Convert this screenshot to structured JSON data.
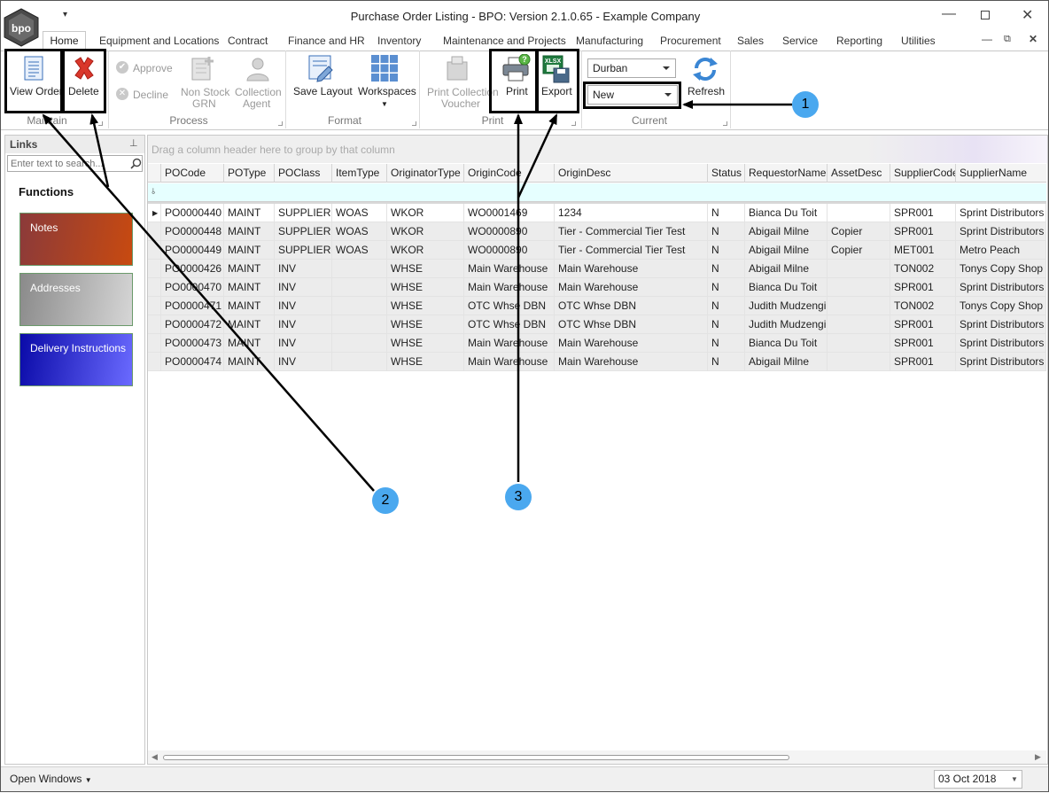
{
  "window": {
    "title": "Purchase Order Listing - BPO: Version 2.1.0.65 - Example Company",
    "logo_text": "bpo"
  },
  "menu_tabs": [
    "Home",
    "Equipment and Locations",
    "Contract",
    "Finance and HR",
    "Inventory",
    "Maintenance and Projects",
    "Manufacturing",
    "Procurement",
    "Sales",
    "Service",
    "Reporting",
    "Utilities"
  ],
  "ribbon": {
    "maintain": {
      "group": "Maintain",
      "view_order": "View Order",
      "delete": "Delete"
    },
    "process": {
      "group": "Process",
      "approve": "Approve",
      "decline": "Decline",
      "non_stock_1": "Non Stock",
      "non_stock_2": "GRN",
      "collection_1": "Collection",
      "collection_2": "Agent"
    },
    "format": {
      "group": "Format",
      "save_layout": "Save Layout",
      "workspaces": "Workspaces"
    },
    "print": {
      "group": "Print",
      "print_voucher_1": "Print Collection",
      "print_voucher_2": "Voucher",
      "print": "Print",
      "export": "Export",
      "xlsx_badge": "XLSX"
    },
    "current": {
      "group": "Current",
      "site": "Durban",
      "status": "New",
      "refresh": "Refresh"
    }
  },
  "links_panel": {
    "title": "Links",
    "search_placeholder": "Enter text to search...",
    "functions_heading": "Functions",
    "tiles": [
      "Notes",
      "Addresses",
      "Delivery Instructions"
    ]
  },
  "grid": {
    "group_hint": "Drag a column header here to group by that column",
    "columns": [
      "POCode",
      "POType",
      "POClass",
      "ItemType",
      "OriginatorType",
      "OriginCode",
      "OriginDesc",
      "Status",
      "RequestorName",
      "AssetDesc",
      "SupplierCode",
      "SupplierName"
    ],
    "rows": [
      [
        "PO0000440",
        "MAINT",
        "SUPPLIER",
        "WOAS",
        "WKOR",
        "WO0001469",
        "1234",
        "N",
        "Bianca Du Toit",
        "",
        "SPR001",
        "Sprint Distributors Lo"
      ],
      [
        "PO0000448",
        "MAINT",
        "SUPPLIER",
        "WOAS",
        "WKOR",
        "WO0000890",
        "Tier - Commercial Tier Test",
        "N",
        "Abigail Milne",
        "Copier",
        "SPR001",
        "Sprint Distributors Lo"
      ],
      [
        "PO0000449",
        "MAINT",
        "SUPPLIER",
        "WOAS",
        "WKOR",
        "WO0000890",
        "Tier - Commercial Tier Test",
        "N",
        "Abigail Milne",
        "Copier",
        "MET001",
        "Metro Peach"
      ],
      [
        "PO0000426",
        "MAINT",
        "INV",
        "",
        "WHSE",
        "Main Warehouse",
        "Main Warehouse",
        "N",
        "Abigail Milne",
        "",
        "TON002",
        "Tonys Copy Shop"
      ],
      [
        "PO0000470",
        "MAINT",
        "INV",
        "",
        "WHSE",
        "Main Warehouse",
        "Main Warehouse",
        "N",
        "Bianca Du Toit",
        "",
        "SPR001",
        "Sprint Distributors Lo"
      ],
      [
        "PO0000471",
        "MAINT",
        "INV",
        "",
        "WHSE",
        "OTC Whse DBN",
        "OTC Whse DBN",
        "N",
        "Judith Mudzengi",
        "",
        "TON002",
        "Tonys Copy Shop"
      ],
      [
        "PO0000472",
        "MAINT",
        "INV",
        "",
        "WHSE",
        "OTC Whse DBN",
        "OTC Whse DBN",
        "N",
        "Judith Mudzengi",
        "",
        "SPR001",
        "Sprint Distributors Lo"
      ],
      [
        "PO0000473",
        "MAINT",
        "INV",
        "",
        "WHSE",
        "Main Warehouse",
        "Main Warehouse",
        "N",
        "Bianca Du Toit",
        "",
        "SPR001",
        "Sprint Distributors Lo"
      ],
      [
        "PO0000474",
        "MAINT",
        "INV",
        "",
        "WHSE",
        "Main Warehouse",
        "Main Warehouse",
        "N",
        "Abigail Milne",
        "",
        "SPR001",
        "Sprint Distributors Lo"
      ]
    ]
  },
  "status_bar": {
    "open_windows": "Open Windows",
    "date": "03 Oct 2018"
  },
  "callouts": [
    "1",
    "2",
    "3"
  ],
  "colors": {
    "callout": "#4aa8ef",
    "notes_tile": "#c84a10",
    "addresses_tile": "#b5b5b5",
    "delivery_tile": "#1010b8",
    "filter_row": "#e6ffff"
  }
}
